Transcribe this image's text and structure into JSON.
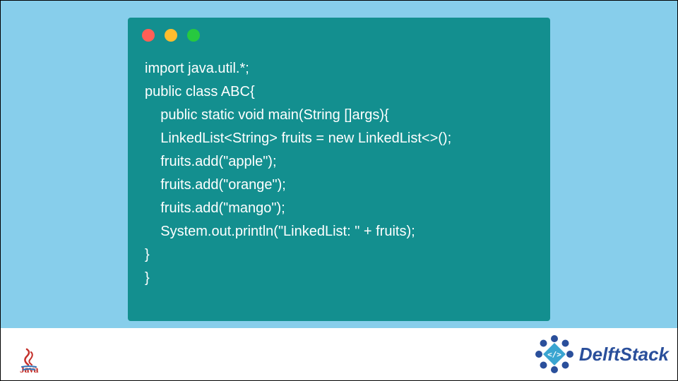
{
  "window": {
    "traffic_lights": [
      "red",
      "yellow",
      "green"
    ]
  },
  "code": {
    "lines": [
      "import java.util.*;",
      "public class ABC{",
      "    public static void main(String []args){",
      "    LinkedList<String> fruits = new LinkedList<>();",
      "    fruits.add(\"apple\");",
      "    fruits.add(\"orange\");",
      "    fruits.add(\"mango\");",
      "    System.out.println(\"LinkedList: \" + fruits);",
      "}",
      "}"
    ]
  },
  "logos": {
    "java_label": "Java",
    "delft_label": "DelftStack"
  }
}
